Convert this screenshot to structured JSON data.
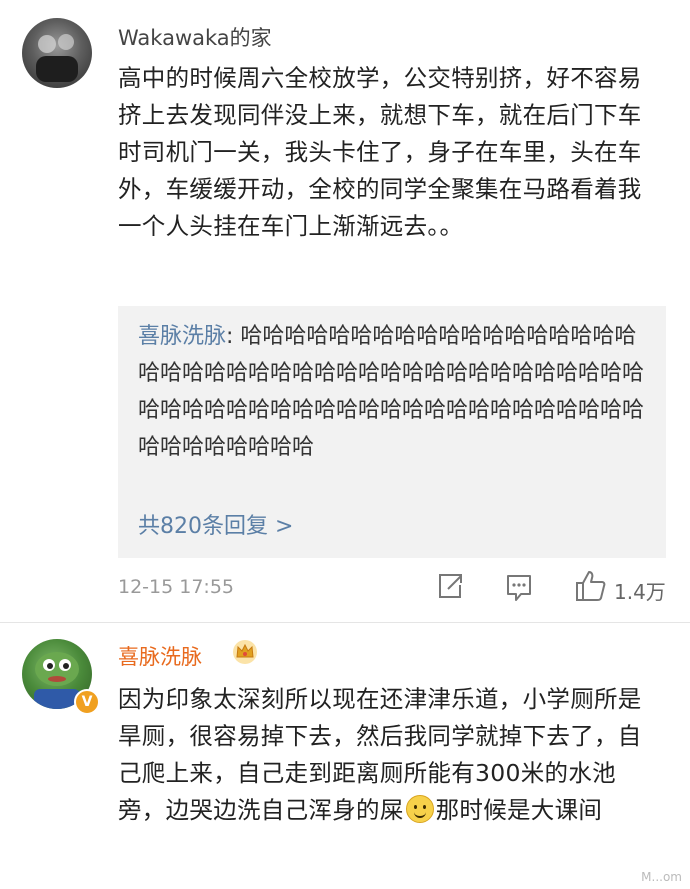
{
  "comment1": {
    "username": "Wakawaka的家",
    "text": "高中的时候周六全校放学，公交特别挤，好不容易挤上去发现同伴没上来，就想下车，就在后门下车时司机门一关，我头卡住了，身子在车里，头在车外，车缓缓开动，全校的同学全聚集在马路看着我一个人头挂在车门上渐渐远去。。",
    "reply": {
      "user": "喜脉洗脉",
      "separator": ": ",
      "text": "哈哈哈哈哈哈哈哈哈哈哈哈哈哈哈哈哈哈哈哈哈哈哈哈哈哈哈哈哈哈哈哈哈哈哈哈哈哈哈哈哈哈哈哈哈哈哈哈哈哈哈哈哈哈哈哈哈哈哈哈哈哈哈哈哈哈哈哈哈哈哈哈"
    },
    "more_replies": "共820条回复 >",
    "timestamp": "12-15 17:55",
    "like_count": "1.4万"
  },
  "comment2": {
    "username": "喜脉洗脉",
    "verified_badge": "V",
    "text_before_emoji": "因为印象太深刻所以现在还津津乐道，小学厕所是旱厕，很容易掉下去，然后我同学就掉下去了，自己爬上来，自己走到距离厕所能有300米的水池旁，边哭边洗自己浑身的屎",
    "emoji": "smile-emoji",
    "text_after_emoji": "那时候是大课间"
  },
  "watermark": "M...om",
  "icons": {
    "share": "share-icon",
    "comment": "comment-icon",
    "like": "thumbs-up-icon",
    "crown": "crown-icon"
  },
  "colors": {
    "link_blue": "#5b7fa6",
    "username_orange": "#e86a1e",
    "reply_bg": "#f2f2f2"
  }
}
